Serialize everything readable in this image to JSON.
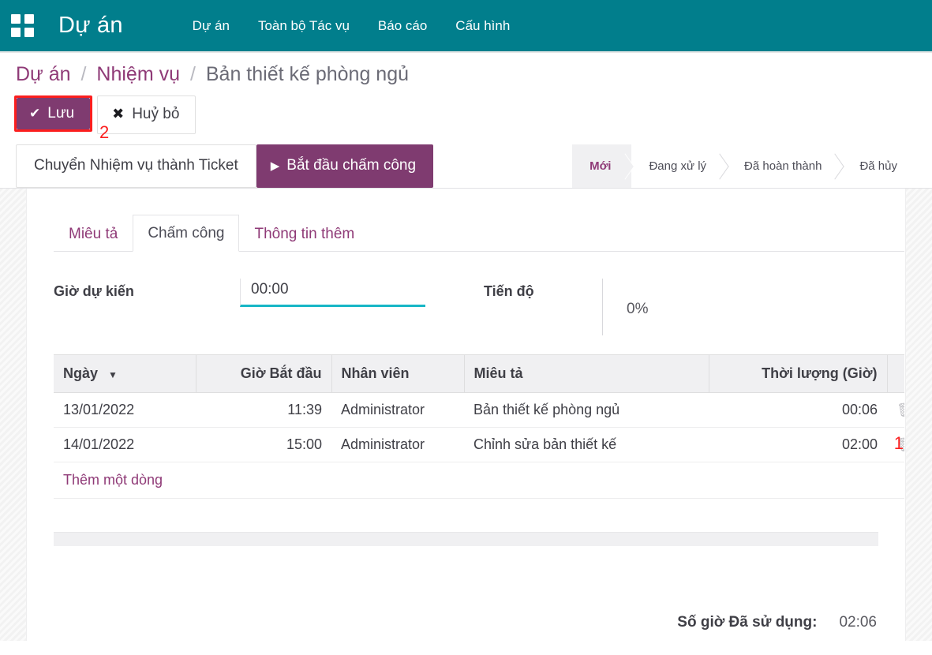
{
  "navbar": {
    "apps_icon": "apps-grid-icon",
    "brand": "Dự án",
    "menu": [
      {
        "label": "Dự án"
      },
      {
        "label": "Toàn bộ Tác vụ"
      },
      {
        "label": "Báo cáo"
      },
      {
        "label": "Cấu hình"
      }
    ],
    "bg_color": "#017e8c"
  },
  "breadcrumb": {
    "items": [
      {
        "label": "Dự án",
        "current": false
      },
      {
        "label": "Nhiệm vụ",
        "current": false
      },
      {
        "label": "Bản thiết kế phòng ngủ",
        "current": true
      }
    ],
    "separator": "/"
  },
  "edit_bar": {
    "save_label": "Lưu",
    "save_icon": "check-icon",
    "discard_label": "Huỷ bỏ",
    "discard_icon": "close-x-icon",
    "annotation": "2",
    "annotation_color": "#fb1e1e",
    "accent_color": "#7f3b70"
  },
  "action_bar": {
    "convert_label": "Chuyển Nhiệm vụ thành Ticket",
    "start_timer_label": "Bắt đầu chấm công",
    "start_timer_icon": "play-icon"
  },
  "statusbar": {
    "stages": [
      {
        "label": "Mới",
        "active": true
      },
      {
        "label": "Đang xử lý",
        "active": false
      },
      {
        "label": "Đã hoàn thành",
        "active": false
      },
      {
        "label": "Đã hủy",
        "active": false
      }
    ],
    "active_color": "#8f3a77"
  },
  "tabs": [
    {
      "label": "Miêu tả",
      "active": false
    },
    {
      "label": "Chấm công",
      "active": true
    },
    {
      "label": "Thông tin thêm",
      "active": false
    }
  ],
  "form": {
    "planned_hours_label": "Giờ dự kiến",
    "planned_hours_value": "00:00",
    "planned_hours_placeholder": "00:00",
    "progress_label": "Tiến độ",
    "progress_value": "0%",
    "underline_color": "#17b6c6"
  },
  "timesheet": {
    "columns": [
      {
        "label": "Ngày",
        "sort_icon": "caret-down-icon",
        "align": "left"
      },
      {
        "label": "Giờ Bắt đầu",
        "align": "right"
      },
      {
        "label": "Nhân viên",
        "align": "left"
      },
      {
        "label": "Miêu tả",
        "align": "left"
      },
      {
        "label": "Thời lượng (Giờ)",
        "align": "right"
      }
    ],
    "rows": [
      {
        "date": "13/01/2022",
        "start_time": "11:39",
        "employee": "Administrator",
        "description": "Bản thiết kế phòng ngủ",
        "duration": "00:06",
        "delete_icon": "trash-icon",
        "highlighted": false
      },
      {
        "date": "14/01/2022",
        "start_time": "15:00",
        "employee": "Administrator",
        "description": "Chỉnh sửa bản thiết kế",
        "duration": "02:00",
        "delete_icon": "trash-icon",
        "highlighted": true
      }
    ],
    "add_line_label": "Thêm một dòng",
    "row_annotation": "1",
    "row_annotation_color": "#fb1e1e"
  },
  "totals": {
    "label": "Số giờ Đã sử dụng:",
    "value": "02:06"
  }
}
